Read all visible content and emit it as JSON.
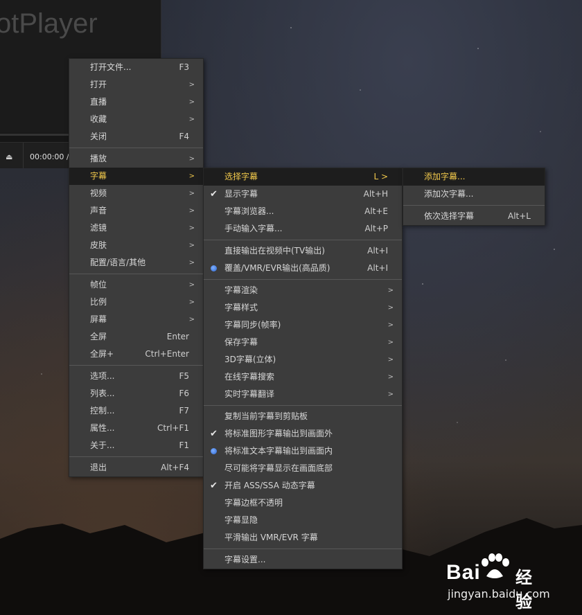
{
  "player": {
    "logo_text": "otPlayer",
    "eject_icon": "eject-icon",
    "time": "00:00:00",
    "time_sep": "/"
  },
  "main_menu": [
    {
      "label": "打开文件...",
      "shortcut": "F3"
    },
    {
      "label": "打开",
      "arrow": ">"
    },
    {
      "label": "直播",
      "arrow": ">"
    },
    {
      "label": "收藏",
      "arrow": ">"
    },
    {
      "label": "关闭",
      "shortcut": "F4"
    },
    {
      "label": "播放",
      "arrow": ">"
    },
    {
      "label": "字幕",
      "arrow": ">",
      "active": true
    },
    {
      "label": "视频",
      "arrow": ">"
    },
    {
      "label": "声音",
      "arrow": ">"
    },
    {
      "label": "滤镜",
      "arrow": ">"
    },
    {
      "label": "皮肤",
      "arrow": ">"
    },
    {
      "label": "配置/语言/其他",
      "arrow": ">"
    },
    {
      "label": "帧位",
      "arrow": ">"
    },
    {
      "label": "比例",
      "arrow": ">"
    },
    {
      "label": "屏幕",
      "arrow": ">"
    },
    {
      "label": "全屏",
      "shortcut": "Enter"
    },
    {
      "label": "全屏+",
      "shortcut": "Ctrl+Enter"
    },
    {
      "label": "选项...",
      "shortcut": "F5"
    },
    {
      "label": "列表...",
      "shortcut": "F6"
    },
    {
      "label": "控制...",
      "shortcut": "F7"
    },
    {
      "label": "属性...",
      "shortcut": "Ctrl+F1"
    },
    {
      "label": "关于...",
      "shortcut": "F1"
    },
    {
      "label": "退出",
      "shortcut": "Alt+F4"
    }
  ],
  "subtitle_menu": [
    {
      "label": "选择字幕",
      "shortcut": "L >",
      "active": true
    },
    {
      "label": "显示字幕",
      "shortcut": "Alt+H",
      "check": true
    },
    {
      "label": "字幕浏览器...",
      "shortcut": "Alt+E"
    },
    {
      "label": "手动输入字幕...",
      "shortcut": "Alt+P"
    },
    {
      "label": "直接输出在视频中(TV输出)",
      "shortcut": "Alt+I"
    },
    {
      "label": "覆盖/VMR/EVR输出(高品质)",
      "shortcut": "Alt+I",
      "radio": true
    },
    {
      "label": "字幕渲染",
      "arrow": ">"
    },
    {
      "label": "字幕样式",
      "arrow": ">"
    },
    {
      "label": "字幕同步(帧率)",
      "arrow": ">"
    },
    {
      "label": "保存字幕",
      "arrow": ">"
    },
    {
      "label": "3D字幕(立体)",
      "arrow": ">"
    },
    {
      "label": "在线字幕搜索",
      "arrow": ">"
    },
    {
      "label": "实时字幕翻译",
      "arrow": ">"
    },
    {
      "label": "复制当前字幕到剪贴板"
    },
    {
      "label": "将标准图形字幕输出到画面外",
      "check": true
    },
    {
      "label": "将标准文本字幕输出到画面内",
      "radio": true
    },
    {
      "label": "尽可能将字幕显示在画面底部"
    },
    {
      "label": "开启 ASS/SSA 动态字幕",
      "check": true
    },
    {
      "label": "字幕边框不透明"
    },
    {
      "label": "字幕显隐"
    },
    {
      "label": "平滑输出 VMR/EVR 字幕"
    },
    {
      "label": "字幕设置..."
    }
  ],
  "select_menu": [
    {
      "label": "添加字幕...",
      "active": true
    },
    {
      "label": "添加次字幕..."
    },
    {
      "label": "依次选择字幕",
      "shortcut": "Alt+L"
    }
  ],
  "watermark": {
    "brand": "Bai",
    "cn": "经验",
    "url": "jingyan.baidu.com"
  }
}
